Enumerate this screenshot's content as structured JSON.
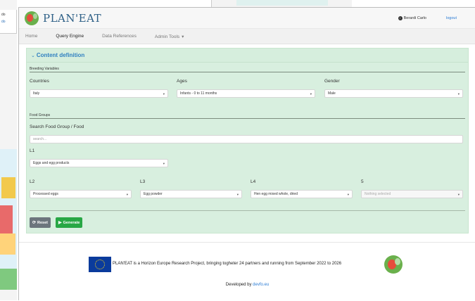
{
  "background": {
    "left_text": "do",
    "left_link": "do"
  },
  "app": {
    "logo_text": "PLAN'EAT",
    "user_name": "Berardi Carlo",
    "logout": "logout"
  },
  "nav": {
    "items": [
      {
        "label": "Home"
      },
      {
        "label": "Query Engine"
      },
      {
        "label": "Data References"
      },
      {
        "label": "Admin Tools"
      }
    ],
    "admin_caret": "▾"
  },
  "panel": {
    "title": "Content definition",
    "breeding_section": "Breeding Variables",
    "countries": {
      "label": "Countries",
      "value": "Italy"
    },
    "ages": {
      "label": "Ages",
      "value": "Infants - 0 to 11 months"
    },
    "gender": {
      "label": "Gender",
      "value": "Male"
    },
    "food_section": "Food Groups",
    "search": {
      "label": "Search Food Group / Food",
      "placeholder": "search..."
    },
    "l1": {
      "label": "L1",
      "value": "Eggs and egg products"
    },
    "l2": {
      "label": "L2",
      "value": "Processed eggs"
    },
    "l3": {
      "label": "L3",
      "value": "Egg powder"
    },
    "l4": {
      "label": "L4",
      "value": "Hen egg mixed whole, dried"
    },
    "l5": {
      "label": "5",
      "value": "Nothing selected"
    },
    "reset": "Reset",
    "generate": "Generate"
  },
  "footer": {
    "text": "PLAN'EAT is a Horizon Europe Research Project, bringing togheter 24 partners and running from September 2022 to 2026",
    "dev_prefix": "Developed by",
    "dev_link": "devfo.eu"
  }
}
